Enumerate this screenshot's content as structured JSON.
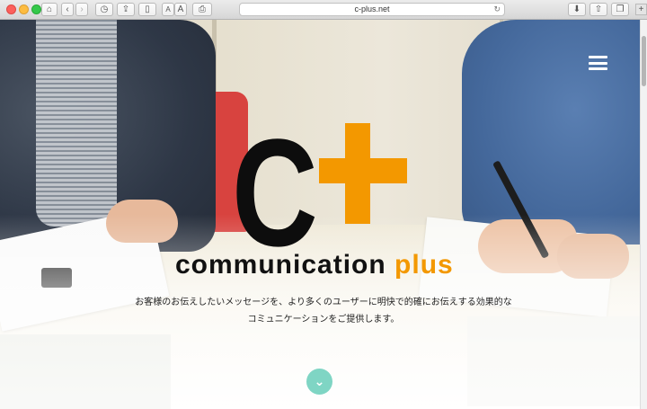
{
  "browser": {
    "url": "c-plus.net",
    "icons": [
      "home-icon",
      "back-icon",
      "forward-icon",
      "history-icon",
      "share-icon",
      "sidebar-icon",
      "reload-icon",
      "download-icon",
      "tabs-icon"
    ],
    "font_small": "A",
    "font_large": "A"
  },
  "hero": {
    "logo_letter": "C",
    "tagline_part1": "communication",
    "tagline_part2": "plus",
    "description_line1": "お客様のお伝えしたいメッセージを、より多くのユーザーに明快で的確にお伝えする効果的な",
    "description_line2": "コミュニケーションをご提供します。",
    "scroll_label": "⌄"
  },
  "colors": {
    "accent_orange": "#f39800",
    "scroll_button": "#7fd5c4"
  }
}
